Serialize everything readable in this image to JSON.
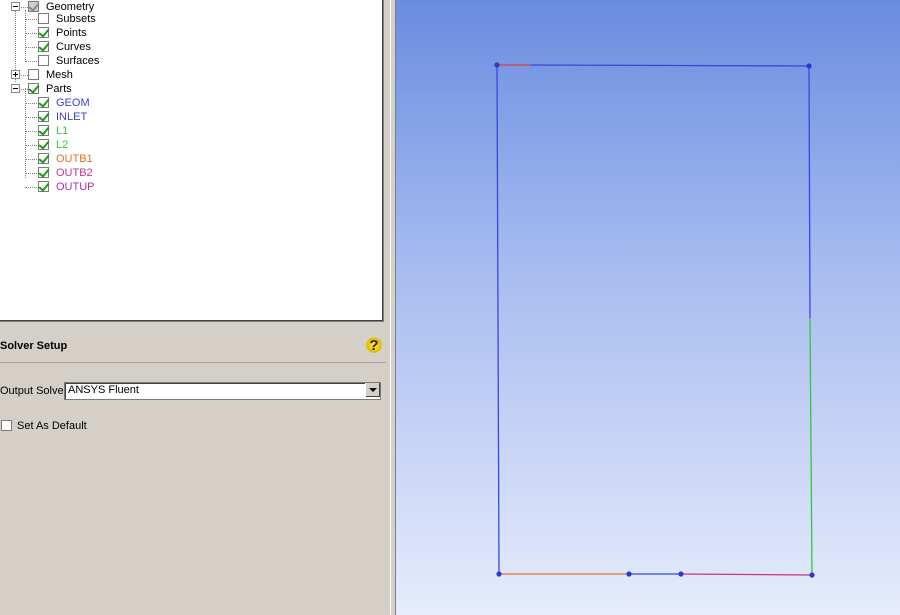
{
  "tree": {
    "geometry": "Geometry",
    "subsets": "Subsets",
    "points": "Points",
    "curves": "Curves",
    "surfaces": "Surfaces",
    "mesh": "Mesh",
    "parts": "Parts",
    "part_items": [
      {
        "label": "GEOM",
        "color": "#3a46c8"
      },
      {
        "label": "INLET",
        "color": "#3a46c8"
      },
      {
        "label": "L1",
        "color": "#2ec83a"
      },
      {
        "label": "L2",
        "color": "#2ec83a"
      },
      {
        "label": "OUTB1",
        "color": "#e0702a"
      },
      {
        "label": "OUTB2",
        "color": "#c8348a"
      },
      {
        "label": "OUTUP",
        "color": "#b030b0"
      }
    ]
  },
  "solver_setup": {
    "title": "Solver Setup",
    "help_icon": "?",
    "output_solver_label": "Output Solver",
    "output_solver_value": "ANSYS Fluent",
    "set_as_default_label": "Set As Default"
  },
  "viewport": {
    "edge_colors": {
      "geom": "#3a46e0",
      "inlet": "#d04040",
      "l2": "#2ec83a",
      "outb1": "#e0702a",
      "outb2": "#c8348a",
      "vertex": "#2a3ad0"
    }
  }
}
